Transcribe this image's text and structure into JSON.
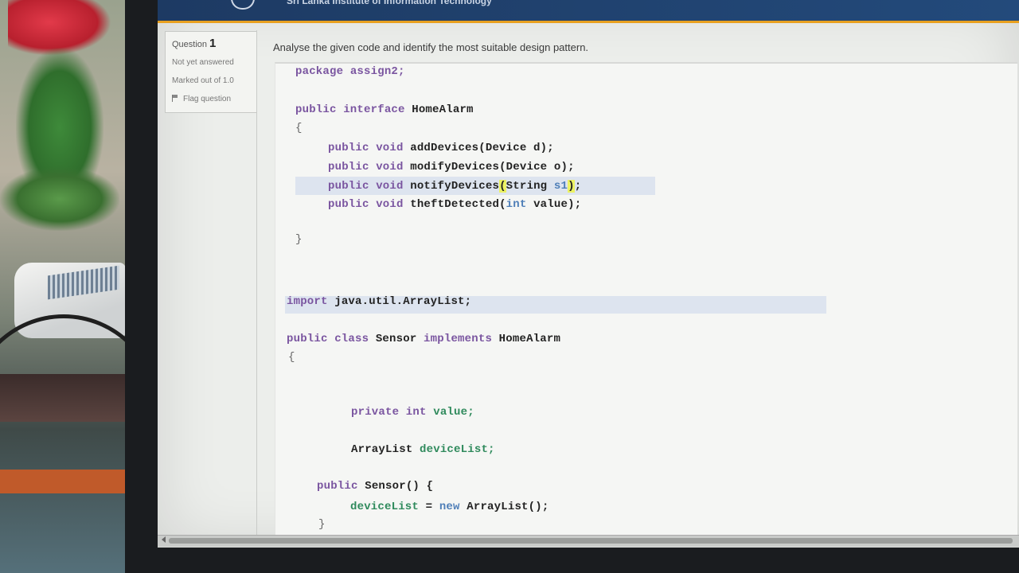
{
  "header": {
    "title": "Sri Lanka Institute of Information Technology"
  },
  "question_info": {
    "label": "Question",
    "number": "1",
    "state": "Not yet answered",
    "marks": "Marked out of 1.0",
    "flag_label": "Flag question"
  },
  "question": {
    "text": "Analyse the given code and identify the most suitable design pattern."
  },
  "code": {
    "package_kw": "package",
    "package_name": "assign2;",
    "iface_kw": "public interface",
    "iface_name": "HomeAlarm",
    "open_brace": "{",
    "close_brace": "}",
    "method_prefix": "public void",
    "m1_name": "addDevices",
    "m1_args": "(Device d);",
    "m2_name": "modifyDevices",
    "m2_args": "(Device o);",
    "m3_name": "notifyDevices",
    "m3_open": "(",
    "m3_type": "String",
    "m3_param": "s1",
    "m3_close": ")",
    "m3_semi": ";",
    "m4_name": "theftDetected",
    "m4_open": "(",
    "m4_type": "int",
    "m4_rest": " value);",
    "import_kw": "import",
    "import_pkg": "java.util.ArrayList;",
    "class_kw": "public class",
    "class_name": "Sensor",
    "implements_kw": "implements",
    "implements_name": "HomeAlarm",
    "f1_kw": "private int",
    "f1_name": "value;",
    "f2_type": "ArrayList",
    "f2_name": "deviceList;",
    "ctor_kw": "public",
    "ctor_name": "Sensor",
    "ctor_args": "() {",
    "ctor_body_field": "deviceList",
    "ctor_body_op": " = ",
    "ctor_body_new": "new",
    "ctor_body_type": " ArrayList",
    "ctor_body_end": "();",
    "ctor_close": "}"
  }
}
